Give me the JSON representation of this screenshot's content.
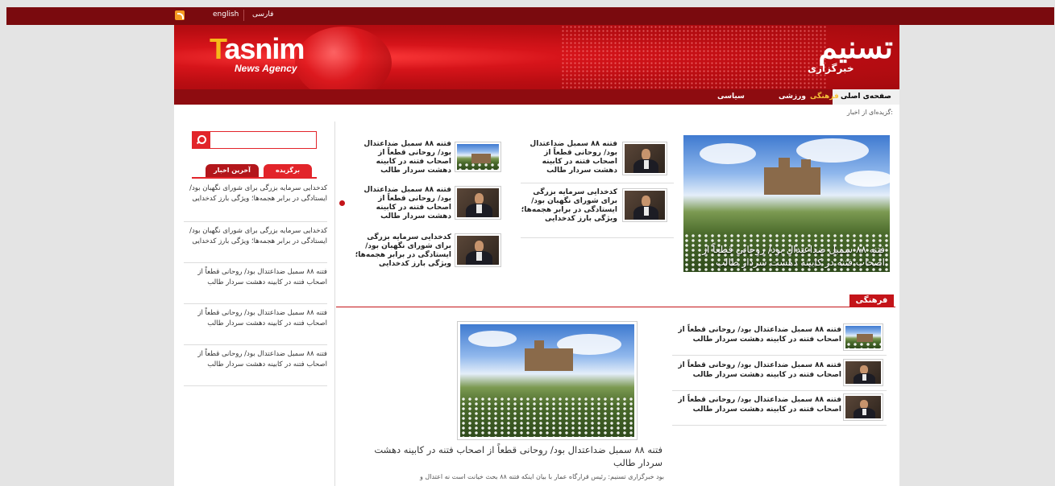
{
  "topbar": {
    "rss_icon": "rss-icon",
    "lang_en": "english",
    "lang_fa": "فارسی"
  },
  "header": {
    "logo_en": "Tasnim",
    "logo_sub": "News Agency",
    "logo_fa": "تسنیم",
    "logo_fa_sub": "خبرگزاری"
  },
  "nav": {
    "home": "صفحه‌ی اصلی",
    "culture": "فرهنگی",
    "sports": "ورزشی",
    "politics": "سیاسی"
  },
  "picks_label": "گزیده‌ای از اخبار:",
  "featured": {
    "caption": "فتنه ۸۸ سمبل ضداعتدال بود/ روحانی قطعاً از اصحاب فتنه در کابینه دهشت سردار طالب"
  },
  "col_middle": [
    {
      "title": "فتنه ۸۸ سمبل ضداعتدال بود/ روحانی قطعاً از اصحاب فتنه در کابینه دهشت سردار طالب"
    },
    {
      "title": "کدخدایی سرمایه بزرگی برای شورای نگهبان بود/ ایستادگی در برابر هجمه‌ها؛ ویژگی بارز کدخدایی"
    }
  ],
  "col_left": [
    {
      "title": "فتنه ۸۸ سمبل ضداعتدال بود/ روحانی قطعاً از اصحاب فتنه در کابینه دهشت سردار طالب"
    },
    {
      "title": "فتنه ۸۸ سمبل ضداعتدال بود/ روحانی قطعاً از اصحاب فتنه در کابینه دهشت سردار طالب"
    },
    {
      "title": "کدخدایی سرمایه بزرگی برای شورای نگهبان بود/ ایستادگی در برابر هجمه‌ها؛ ویژگی بارز کدخدایی"
    }
  ],
  "sidebar": {
    "search_placeholder": "",
    "tab_featured": "برگزیده",
    "tab_latest": "آخرین اخبار",
    "items": [
      "کدخدایی سرمایه بزرگی برای شورای نگهبان بود/ ایستادگی در برابر هجمه‌ها؛ ویژگی بارز کدخدایی",
      "کدخدایی سرمایه بزرگی برای شورای نگهبان بود/ ایستادگی در برابر هجمه‌ها؛ ویژگی بارز کدخدایی",
      "فتنه ۸۸ سمبل ضداعتدال بود/ روحانی قطعاً از اصحاب فتنه در کابینه دهشت سردار طالب",
      "فتنه ۸۸ سمبل ضداعتدال بود/ روحانی قطعاً از اصحاب فتنه در کابینه دهشت سردار طالب",
      "فتنه ۸۸ سمبل ضداعتدال بود/ روحانی قطعاً از اصحاب فتنه در کابینه دهشت سردار طالب"
    ]
  },
  "culture": {
    "label": "فرهنگی",
    "items": [
      "فتنه ۸۸ سمبل ضداعتدال بود/ روحانی قطعاً از اصحاب فتنه در کابینه دهشت سردار طالب",
      "فتنه ۸۸ سمبل ضداعتدال بود/ روحانی قطعاً از اصحاب فتنه در کابینه دهشت سردار طالب",
      "فتنه ۸۸ سمبل ضداعتدال بود/ روحانی قطعاً از اصحاب فتنه در کابینه دهشت سردار طالب"
    ],
    "main_title": "فتنه ۸۸ سمبل ضداعتدال بود/ روحانی قطعاً از اصحاب فتنه در کابینه دهشت سردار طالب",
    "main_lead": "بود خبرگزاری تسنیم: رئیس قرارگاه عمار با بیان اینکه فتنه ۸۸ بحث خیانت است نه اعتدال و"
  }
}
